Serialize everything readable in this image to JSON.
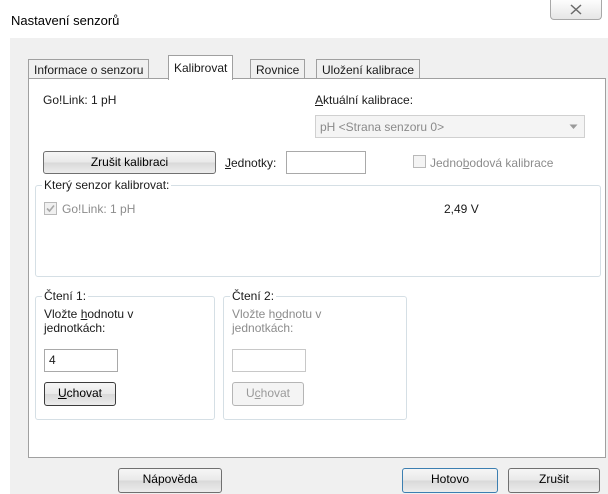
{
  "window": {
    "title": "Nastavení senzorů"
  },
  "tabs": [
    {
      "label": "Informace o senzoru",
      "active": false
    },
    {
      "label": "Kalibrovat",
      "active": true
    },
    {
      "label": "Rovnice",
      "active": false
    },
    {
      "label": "Uložení kalibrace",
      "active": false
    }
  ],
  "calibrate": {
    "sensor_label": "Go!Link: 1 pH",
    "current_calibration_label": "Aktuální kalibrace:",
    "current_calibration_value": "pH <Strana senzoru 0>",
    "cancel_calibration_label": "Zrušit kalibraci",
    "units_label": "Jednotky:",
    "units_value": "",
    "single_point_label": "Jednobodová kalibrace",
    "which_sensor_group": "Který senzor kalibrovat:",
    "sensor_checkbox_label": "Go!Link: 1 pH",
    "sensor_checked": true,
    "sensor_voltage": "2,49 V",
    "reading1": {
      "title": "Čtení 1:",
      "prompt": "Vložte hodnotu v jednotkách:",
      "value": "4",
      "keep_label": "Uchovat"
    },
    "reading2": {
      "title": "Čtení 2:",
      "prompt": "Vložte hodnotu v jednotkách:",
      "value": "",
      "keep_label": "Uchovat"
    }
  },
  "footer": {
    "help_label": "Nápověda",
    "done_label": "Hotovo",
    "cancel_label": "Zrušit"
  }
}
